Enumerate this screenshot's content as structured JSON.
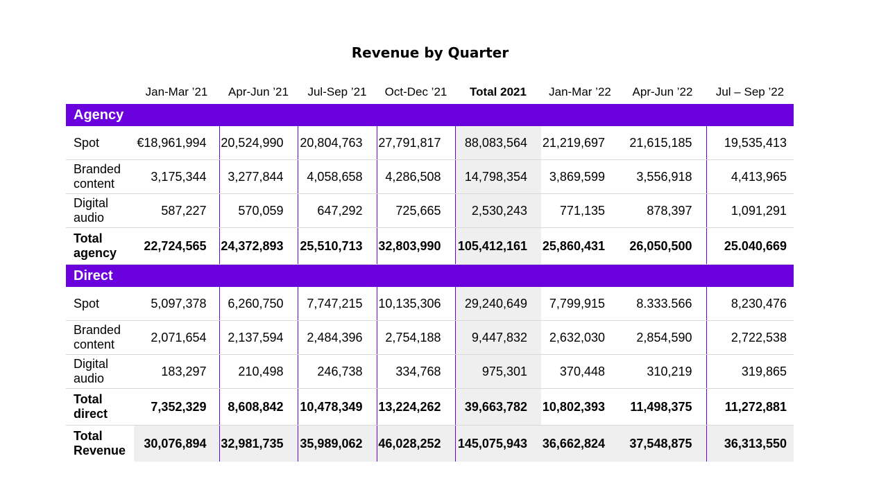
{
  "title": "Revenue by Quarter",
  "columns": [
    "Jan-Mar ’21",
    "Apr-Jun ’21",
    "Jul-Sep ’21",
    "Oct-Dec ’21",
    "Total 2021",
    "Jan-Mar ’22",
    "Apr-Jun ’22",
    "Jul – Sep ’22"
  ],
  "sections": [
    {
      "name": "Agency",
      "rows": [
        {
          "label": [
            "Spot"
          ],
          "values": [
            "€18,961,994",
            "20,524,990",
            "20,804,763",
            "27,791,817",
            "88,083,564",
            "21,219,697",
            "21,615,185",
            "19,535,413"
          ]
        },
        {
          "label": [
            "Branded",
            "content"
          ],
          "values": [
            "3,175,344",
            "3,277,844",
            "4,058,658",
            "4,286,508",
            "14,798,354",
            "3,869,599",
            "3,556,918",
            "4,413,965"
          ]
        },
        {
          "label": [
            "Digital",
            "audio"
          ],
          "values": [
            "587,227",
            "570,059",
            "647,292",
            "725,665",
            "2,530,243",
            "771,135",
            "878,397",
            "1,091,291"
          ]
        },
        {
          "label": [
            "Total",
            "agency"
          ],
          "values": [
            "22,724,565",
            "24,372,893",
            "25,510,713",
            "32,803,990",
            "105,412,161",
            "25,860,431",
            "26,050,500",
            "25.040,669"
          ]
        }
      ]
    },
    {
      "name": "Direct",
      "rows": [
        {
          "label": [
            "Spot"
          ],
          "values": [
            "5,097,378",
            "6,260,750",
            "7,747,215",
            "10,135,306",
            "29,240,649",
            "7,799,915",
            "8.333.566",
            "8,230,476"
          ]
        },
        {
          "label": [
            "Branded",
            "content"
          ],
          "values": [
            "2,071,654",
            "2,137,594",
            "2,484,396",
            "2,754,188",
            "9,447,832",
            "2,632,030",
            "2,854,590",
            "2,722,538"
          ]
        },
        {
          "label": [
            "Digital",
            "audio"
          ],
          "values": [
            "183,297",
            "210,498",
            "246,738",
            "334,768",
            "975,301",
            "370,448",
            "310,219",
            "319,865"
          ]
        },
        {
          "label": [
            "Total",
            "direct"
          ],
          "values": [
            "7,352,329",
            "8,608,842",
            "10,478,349",
            "13,224,262",
            "39,663,782",
            "10,802,393",
            "11,498,375",
            "11,272,881"
          ]
        }
      ]
    }
  ],
  "grand_total": {
    "label": [
      "Total",
      "Revenue"
    ],
    "values": [
      "30,076,894",
      "32,981,735",
      "35,989,062",
      "46,028,252",
      "145,075,943",
      "36,662,824",
      "37,548,875",
      "36,313,550"
    ]
  },
  "colors": {
    "section_band": "#6a00dc",
    "highlight_fill": "#efefef",
    "divider": "#d9d9d9"
  }
}
